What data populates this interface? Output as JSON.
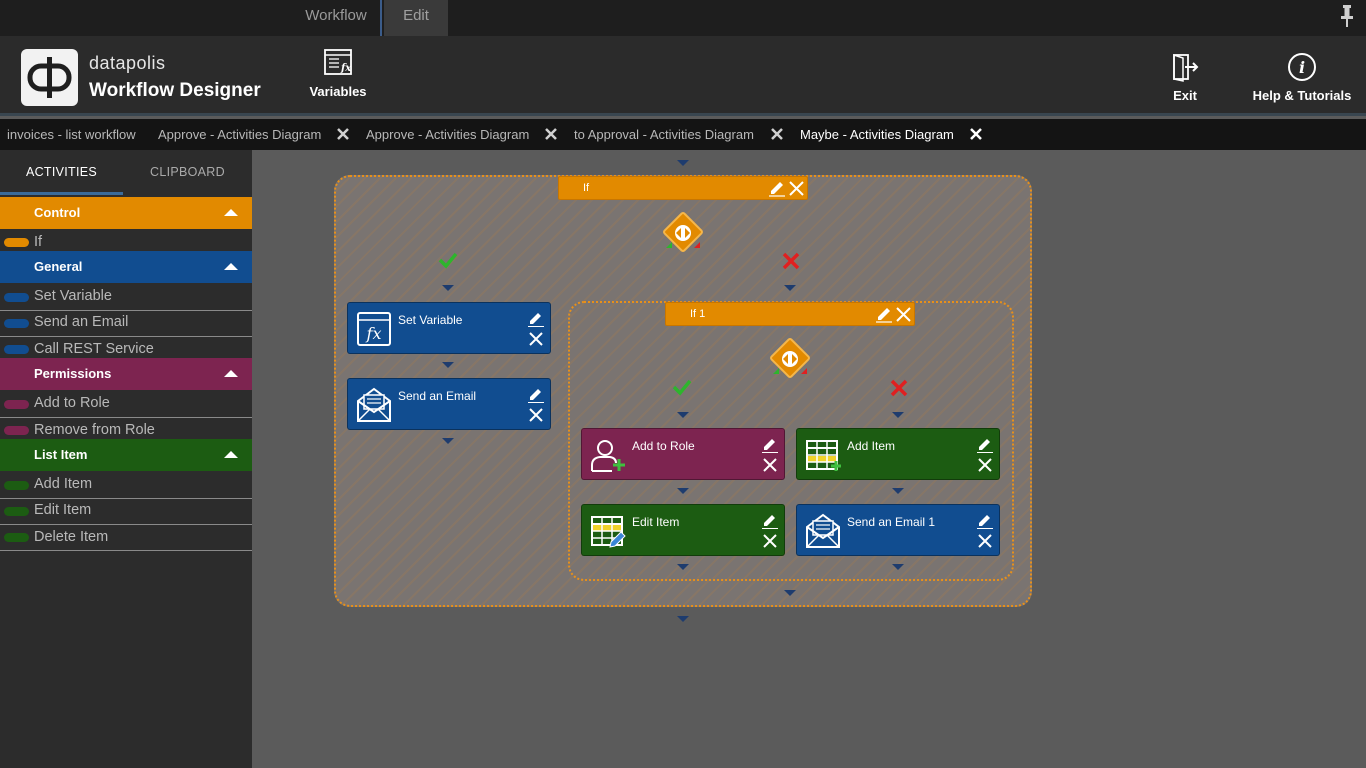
{
  "top_tabs": {
    "workflow": "Workflow",
    "edit": "Edit"
  },
  "brand": {
    "name": "datapolis",
    "product": "Workflow Designer"
  },
  "ribbon": {
    "variables": "Variables",
    "exit": "Exit",
    "help": "Help & Tutorials"
  },
  "doc_tabs": [
    {
      "label": "invoices - list workflow"
    },
    {
      "label": "Approve - Activities Diagram"
    },
    {
      "label": "Approve - Activities Diagram"
    },
    {
      "label": "to Approval - Activities Diagram"
    },
    {
      "label": "Maybe - Activities Diagram"
    }
  ],
  "sidebar": {
    "tabs": {
      "activities": "ACTIVITIES",
      "clipboard": "CLIPBOARD"
    },
    "categories": [
      {
        "label": "Control",
        "color": "#e28a00",
        "items": [
          "If"
        ]
      },
      {
        "label": "General",
        "color": "#114d90",
        "items": [
          "Set Variable",
          "Send an Email",
          "Call REST Service"
        ]
      },
      {
        "label": "Permissions",
        "color": "#7d2450",
        "items": [
          "Add to Role",
          "Remove from Role"
        ]
      },
      {
        "label": "List Item",
        "color": "#1c5c12",
        "items": [
          "Add Item",
          "Edit Item",
          "Delete Item"
        ]
      }
    ]
  },
  "diagram": {
    "outer_if": "If",
    "inner_if": "If 1",
    "activities": {
      "set_variable": "Set Variable",
      "send_email": "Send an Email",
      "add_to_role": "Add to Role",
      "add_item": "Add Item",
      "edit_item": "Edit Item",
      "send_email_1": "Send an Email 1"
    }
  },
  "colors": {
    "control": "#e28a00",
    "general": "#114d90",
    "permissions": "#7d2450",
    "list_item": "#1c5c12",
    "true_mark": "#2db52d",
    "false_mark": "#e02020"
  }
}
